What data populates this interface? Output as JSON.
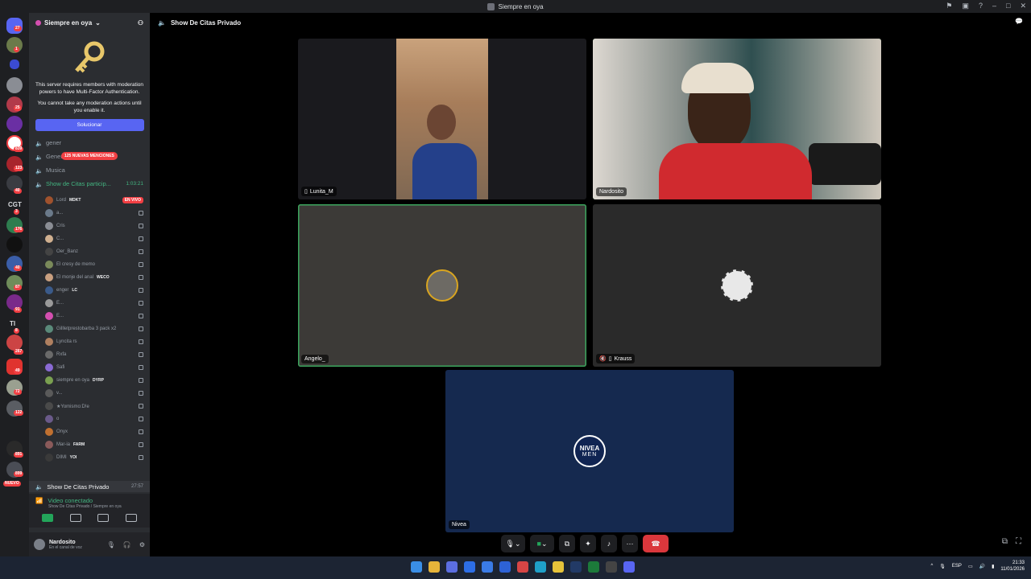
{
  "window": {
    "title": "Siempre en oya"
  },
  "sidebar": {
    "server_name": "Siempre en oya",
    "mfa_message": "This server requires members with moderation powers to have Multi-Factor Authentication.",
    "mfa_note": "You cannot take any moderation actions until you enable it.",
    "fix_button": "Solucionar",
    "new_mentions": "125 NUEVAS MENCIONES",
    "channels": [
      {
        "label": "gener"
      },
      {
        "label": "General"
      },
      {
        "label": "Musica"
      },
      {
        "label": "Show de Citas particip...",
        "time": "1:03:21"
      }
    ],
    "members": [
      {
        "name": "Lord",
        "tag": "MDKT",
        "live": "EN VIVO"
      },
      {
        "name": "a..."
      },
      {
        "name": "Cris"
      },
      {
        "name": "C..."
      },
      {
        "name": "Oer_Banz"
      },
      {
        "name": "El cresy de memo"
      },
      {
        "name": "El monje del anal",
        "tag": "WECO"
      },
      {
        "name": "enger",
        "tag": "LC"
      },
      {
        "name": "E..."
      },
      {
        "name": "E..."
      },
      {
        "name": "Gillletprestobarba 3 pack x2"
      },
      {
        "name": "Lyncita rs"
      },
      {
        "name": "Rxfa"
      },
      {
        "name": "Safi"
      },
      {
        "name": "siempre en oya",
        "tag": "DYRP"
      },
      {
        "name": "v..."
      },
      {
        "name": "★Yomismo:D!e"
      },
      {
        "name": "o"
      },
      {
        "name": "Onyx"
      },
      {
        "name": "Mar-ia",
        "tag": "FARM"
      },
      {
        "name": "DIMI",
        "tag": "YOI"
      }
    ],
    "current_channel": {
      "label": "Show De Citas Privado",
      "time": "27:57"
    },
    "voice": {
      "status": "Video conectado",
      "location": "Show De Citas Privado / Siempre en oya"
    },
    "user": {
      "name": "Nardosito",
      "status": "En el canal de voz"
    }
  },
  "rail": {
    "badges": [
      "27",
      "1",
      "25",
      "839",
      "123",
      "40",
      "3",
      "176",
      "40",
      "87",
      "91",
      "8",
      "267",
      "49",
      "72",
      "122",
      "891",
      "899"
    ],
    "text_items": [
      "CGT",
      "TI"
    ],
    "new_label": "NUEVO"
  },
  "main": {
    "channel_title": "Show De Citas Privado",
    "tiles": [
      {
        "name": "Lunita_M"
      },
      {
        "name": "Nardosito"
      },
      {
        "name": "Angelo_"
      },
      {
        "name": "Krauss"
      },
      {
        "name": "Nivea"
      }
    ],
    "nivea_logo": {
      "line1": "NIVEA",
      "line2": "MEN"
    }
  },
  "taskbar": {
    "lang": "ESP",
    "time": "21:33",
    "date": "11/01/2026"
  },
  "colors": {
    "accent": "#5865f2",
    "speaking": "#3ba55d",
    "danger": "#da373c"
  }
}
